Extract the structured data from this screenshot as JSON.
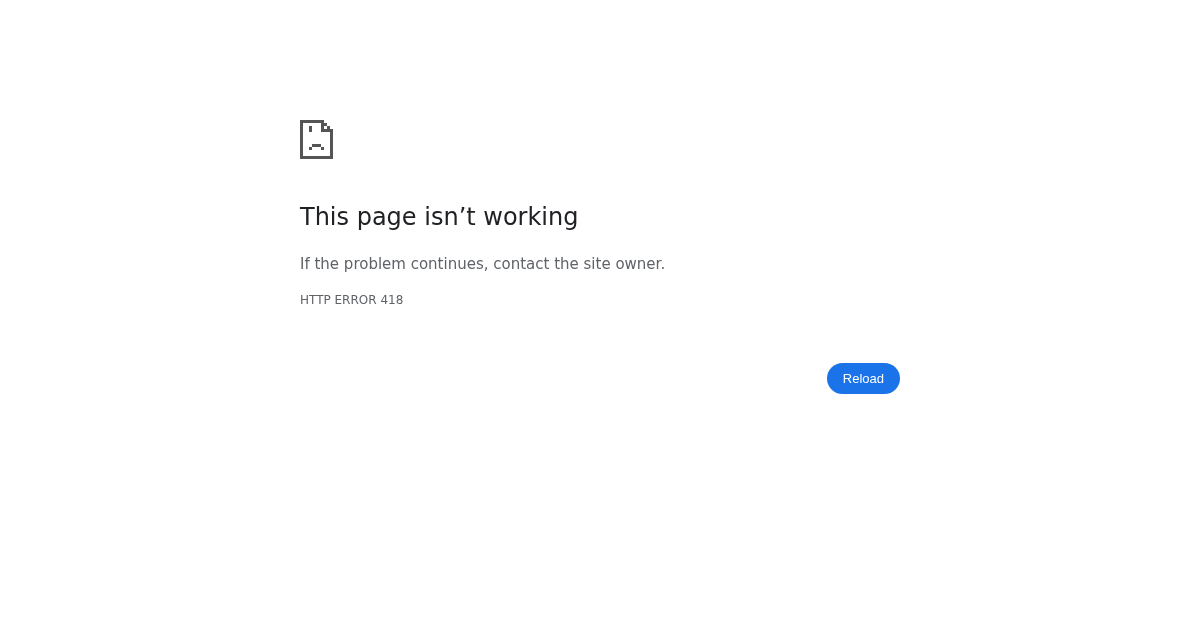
{
  "heading": "This page isn’t working",
  "message": "If the problem continues, contact the site owner.",
  "error_code": "HTTP ERROR 418",
  "reload_button": {
    "label": "Reload"
  }
}
